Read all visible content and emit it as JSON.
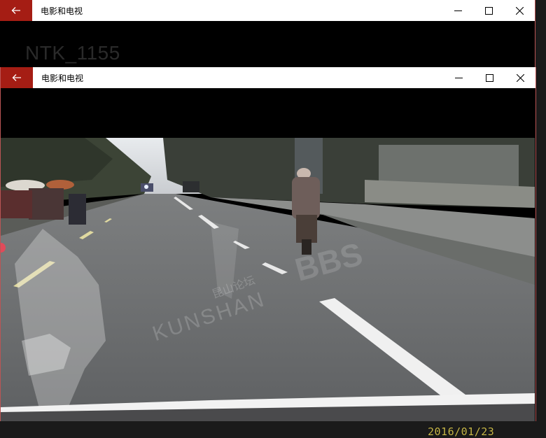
{
  "back_window": {
    "title": "电影和电视",
    "media_title": "NTK_1155"
  },
  "front_window": {
    "title": "电影和电视"
  },
  "icons": {
    "back": "back-arrow-icon",
    "minimize": "minimize-icon",
    "maximize": "maximize-icon",
    "close": "close-icon"
  },
  "colors": {
    "accent": "#a51d14",
    "titlebar": "#ffffff",
    "letterbox": "#000000",
    "timestamp": "#c8b84a"
  },
  "video": {
    "timestamp": "2016/01/23",
    "watermark_cn": "昆山论坛",
    "watermark_en": "KUNSHAN",
    "watermark_bbs": "BBS"
  }
}
